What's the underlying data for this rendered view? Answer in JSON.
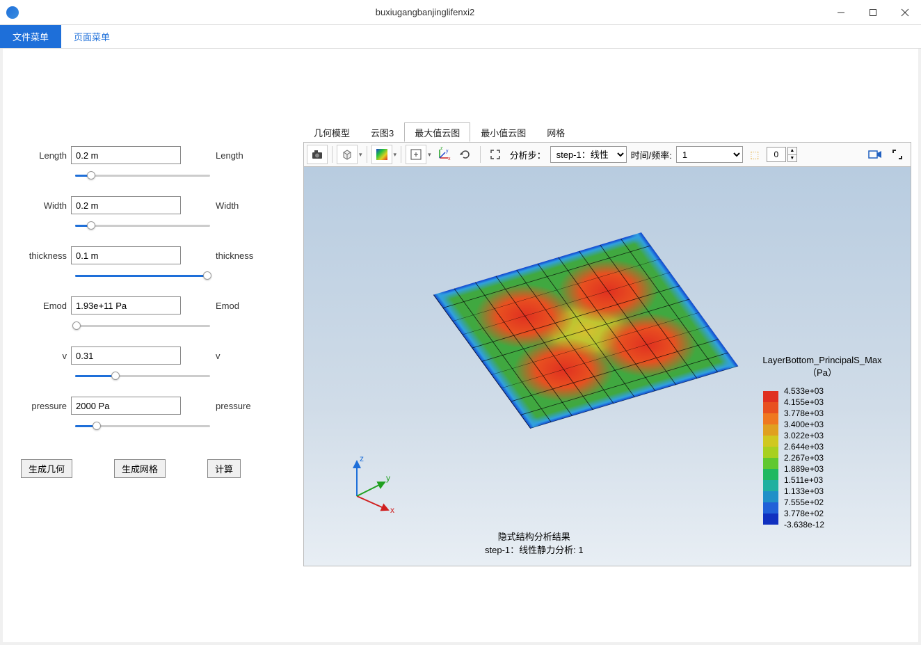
{
  "window": {
    "title": "buxiugangbanjinglifenxi2"
  },
  "menu": {
    "items": [
      "文件菜单",
      "页面菜单"
    ],
    "active": 0
  },
  "params": {
    "items": [
      {
        "name": "Length",
        "value": "0.2 m",
        "right": "Length",
        "slider_pct": 12
      },
      {
        "name": "Width",
        "value": "0.2 m",
        "right": "Width",
        "slider_pct": 12
      },
      {
        "name": "thickness",
        "value": "0.1 m",
        "right": "thickness",
        "slider_pct": 98
      },
      {
        "name": "Emod",
        "value": "1.93e+11 Pa",
        "right": "Emod",
        "slider_pct": 1
      },
      {
        "name": "v",
        "value": "0.31",
        "right": "v",
        "slider_pct": 30
      },
      {
        "name": "pressure",
        "value": "2000 Pa",
        "right": "pressure",
        "slider_pct": 16
      }
    ],
    "buttons": [
      "生成几何",
      "生成网格",
      "计算"
    ]
  },
  "viewer": {
    "tabs": [
      "几何模型",
      "云图3",
      "最大值云图",
      "最小值云图",
      "网格"
    ],
    "active_tab": 2,
    "toolbar": {
      "step_label": "分析步：",
      "step_value": "step-1：线性",
      "timefreq_label": "时间/频率:",
      "timefreq_value": "1",
      "spin_value": "0"
    },
    "result_label": {
      "line1": "隐式结构分析结果",
      "line2": "step-1：线性静力分析: 1"
    },
    "legend": {
      "title": "LayerBottom_PrincipalS_Max",
      "unit": "（Pa）",
      "colors": [
        "#e03020",
        "#e85020",
        "#ef7820",
        "#e0a020",
        "#d0c820",
        "#a8d020",
        "#60c830",
        "#20b860",
        "#20b0a0",
        "#2090c8",
        "#2060d8",
        "#1030c0"
      ],
      "labels": [
        "4.533e+03",
        "4.155e+03",
        "3.778e+03",
        "3.400e+03",
        "3.022e+03",
        "2.644e+03",
        "2.267e+03",
        "1.889e+03",
        "1.511e+03",
        "1.133e+03",
        "7.555e+02",
        "3.778e+02",
        "-3.638e-12"
      ]
    },
    "triad_labels": {
      "x": "x",
      "y": "y",
      "z": "z"
    }
  }
}
